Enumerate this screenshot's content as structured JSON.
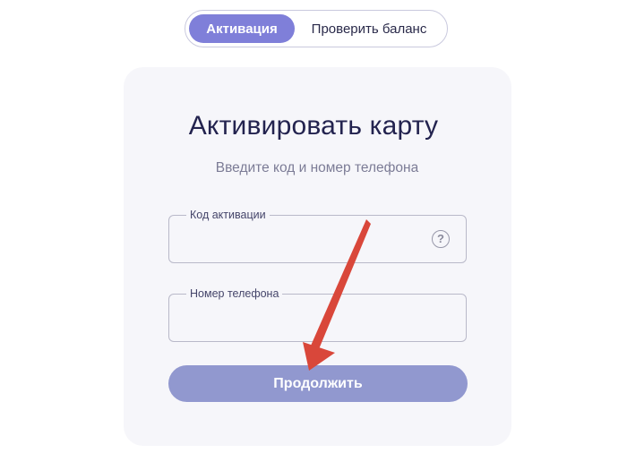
{
  "tabs": {
    "activation": "Активация",
    "check_balance": "Проверить баланс"
  },
  "card": {
    "title": "Активировать карту",
    "subtitle": "Введите код и номер телефона"
  },
  "fields": {
    "code": {
      "label": "Код активации",
      "value": "",
      "help_icon": "question-circle-icon",
      "help_glyph": "?"
    },
    "phone": {
      "label": "Номер телефона",
      "value": ""
    }
  },
  "continue_button": {
    "label": "Продолжить"
  },
  "colors": {
    "accent": "#7f7fd9",
    "button": "#9198cf",
    "annotation_arrow": "#d9473a",
    "title": "#23234f"
  }
}
